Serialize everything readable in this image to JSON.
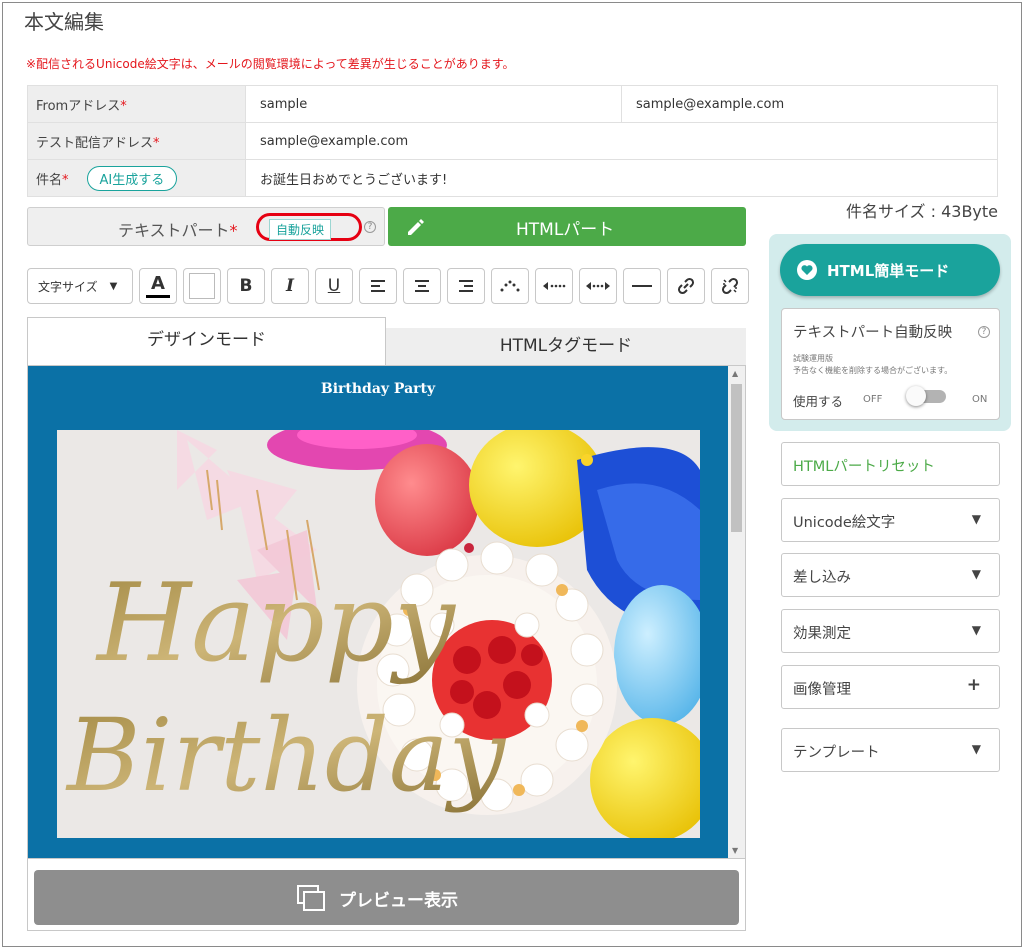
{
  "page": {
    "title": "本文編集",
    "notice": "※配信されるUnicode絵文字は、メールの閲覧環境によって差異が生じることがあります。"
  },
  "form": {
    "from_label": "Fromアドレス",
    "from_name": "sample",
    "from_email": "sample@example.com",
    "test_label": "テスト配信アドレス",
    "test_email": "sample@example.com",
    "subject_label": "件名",
    "ai_button": "AI生成する",
    "subject_value": "お誕生日おめでとうございます!",
    "required_mark": "*"
  },
  "subject_size": "件名サイズ : 43Byte",
  "parts": {
    "text_tab": "テキストパート",
    "auto_reflect": "自動反映",
    "html_tab": "HTMLパート"
  },
  "toolbar": {
    "font_size": "文字サイズ",
    "font_color_letter": "A",
    "bold": "B",
    "italic": "I",
    "underline": "U"
  },
  "editor": {
    "design_tab": "デザインモード",
    "html_tag_tab": "HTMLタグモード",
    "content_title": "Birthday Party",
    "image_text": [
      "Happy",
      "Birthday"
    ]
  },
  "preview_button": "プレビュー表示",
  "right": {
    "easy_mode": "HTML簡単モード",
    "auto_title": "テキストパート自動反映",
    "note1": "試験運用版",
    "note2": "予告なく機能を削除する場合がございます。",
    "use_label": "使用する",
    "off": "OFF",
    "on": "ON",
    "toggle_state": "off",
    "reset": "HTMLパートリセット",
    "unicode_emoji": "Unicode絵文字",
    "insert": "差し込み",
    "measure": "効果測定",
    "image_mgmt": "画像管理",
    "template": "テンプレート"
  },
  "colors": {
    "accent_teal": "#1aa39c",
    "html_green": "#4caa48",
    "required_red": "#e4161c",
    "editor_bg": "#0b71a6",
    "highlight_ring": "#e60012"
  }
}
